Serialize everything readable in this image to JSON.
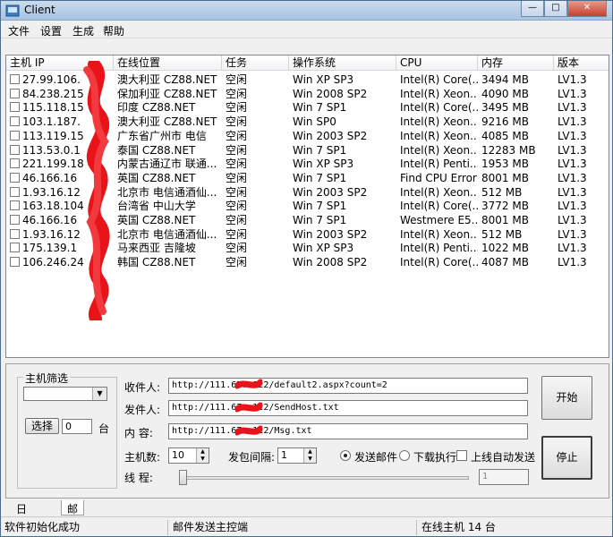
{
  "window": {
    "title": "Client"
  },
  "menu": [
    "文件",
    "设置",
    "生成",
    "帮助"
  ],
  "columns": [
    "主机 IP",
    "在线位置",
    "任务",
    "操作系统",
    "CPU",
    "内存",
    "版本"
  ],
  "rows": [
    [
      "27.99.106.",
      "澳大利亚  CZ88.NET",
      "空闲",
      "Win XP SP3",
      "Intel(R) Core(...",
      "3494 MB",
      "LV1.3"
    ],
    [
      "84.238.215",
      "保加利亚  CZ88.NET",
      "空闲",
      "Win 2008 SP2",
      "Intel(R) Xeon...",
      "4090 MB",
      "LV1.3"
    ],
    [
      "115.118.15",
      "印度  CZ88.NET",
      "空闲",
      "Win 7 SP1",
      "Intel(R) Core(...",
      "3495 MB",
      "LV1.3"
    ],
    [
      "103.1.187.",
      "澳大利亚  CZ88.NET",
      "空闲",
      "Win  SP0",
      "Intel(R) Xeon...",
      "9216 MB",
      "LV1.3"
    ],
    [
      "113.119.15",
      "广东省广州市 电信",
      "空闲",
      "Win 2003 SP2",
      "Intel(R) Xeon...",
      "4085 MB",
      "LV1.3"
    ],
    [
      "113.53.0.1",
      "泰国  CZ88.NET",
      "空闲",
      "Win 7 SP1",
      "Intel(R) Xeon...",
      "12283 MB",
      "LV1.3"
    ],
    [
      "221.199.18",
      "内蒙古通辽市 联通...",
      "空闲",
      "Win XP SP3",
      "Intel(R) Penti...",
      "1953 MB",
      "LV1.3"
    ],
    [
      "46.166.16",
      "英国  CZ88.NET",
      "空闲",
      "Win 7 SP1",
      "Find CPU Error",
      "8001 MB",
      "LV1.3"
    ],
    [
      "1.93.16.12",
      "北京市 电信通酒仙...",
      "空闲",
      "Win 2003 SP2",
      "Intel(R) Xeon...",
      "512 MB",
      "LV1.3"
    ],
    [
      "163.18.104",
      "台湾省 中山大学",
      "空闲",
      "Win 7 SP1",
      "Intel(R) Core(...",
      "3772 MB",
      "LV1.3"
    ],
    [
      "46.166.16",
      "英国  CZ88.NET",
      "空闲",
      "Win 7 SP1",
      "Westmere E5...",
      "8001 MB",
      "LV1.3"
    ],
    [
      "1.93.16.12",
      "北京市 电信通酒仙...",
      "空闲",
      "Win 2003 SP2",
      "Intel(R) Xeon...",
      "512 MB",
      "LV1.3"
    ],
    [
      "175.139.1",
      "马来西亚 吉隆坡",
      "空闲",
      "Win XP SP3",
      "Intel(R) Penti...",
      "1022 MB",
      "LV1.3"
    ],
    [
      "106.246.24",
      "韩国  CZ88.NET",
      "空闲",
      "Win 2008 SP2",
      "Intel(R) Core(...",
      "4087 MB",
      "LV1.3"
    ]
  ],
  "filter": {
    "legend": "主机筛选",
    "select_label": "选择",
    "count_value": "0",
    "unit": "台"
  },
  "form": {
    "recipient_label": "收件人:",
    "recipient_value": "http://111.67.     122/default2.aspx?count=2",
    "sender_label": "发件人:",
    "sender_value": "http://111.67.     122/SendHost.txt",
    "content_label": "内  容:",
    "content_value": "http://111.67.     122/Msg.txt",
    "hosts_label": "主机数:",
    "hosts_value": "10",
    "interval_label": "发包间隔:",
    "interval_value": "1",
    "radio_send": "发送邮件",
    "radio_download": "下载执行",
    "auto_send": "上线自动发送",
    "auto_value": "1",
    "thread_label": "线  程:"
  },
  "buttons": {
    "start": "开始",
    "stop": "停止"
  },
  "tabs": [
    "日志信息",
    "邮件发送"
  ],
  "status": [
    "软件初始化成功",
    "邮件发送主控端",
    "在线主机 14 台"
  ]
}
